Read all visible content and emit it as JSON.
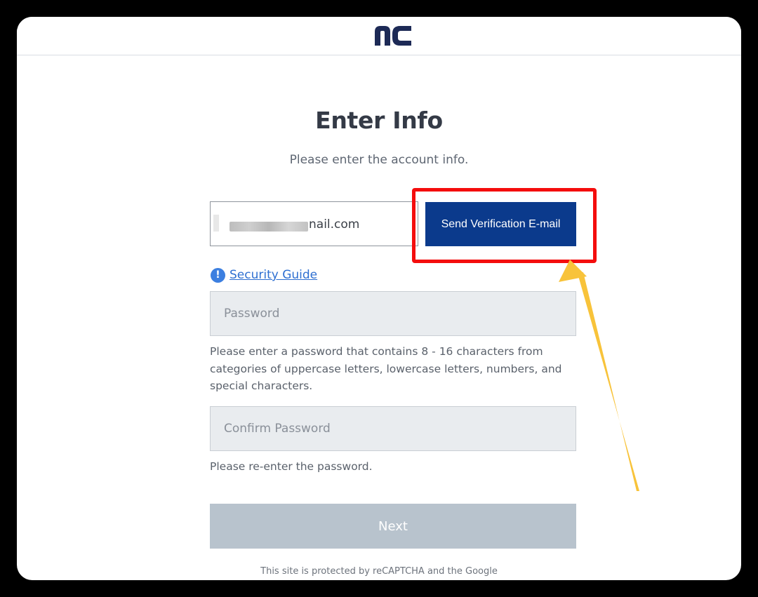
{
  "brand": {
    "logo_text": "nc"
  },
  "form": {
    "title": "Enter Info",
    "subtitle": "Please enter the account info.",
    "email_suffix": "nail.com",
    "send_button_label": "Send Verification E-mail",
    "security_guide_label": "Security Guide",
    "password_placeholder": "Password",
    "password_hint": "Please enter a password that contains 8 - 16 characters from categories of uppercase letters, lowercase letters, numbers, and special characters.",
    "confirm_placeholder": "Confirm Password",
    "confirm_hint": "Please re-enter the password.",
    "next_label": "Next",
    "footer_text": "This site is protected by reCAPTCHA and the Google"
  },
  "icons": {
    "info": "info-icon"
  },
  "colors": {
    "primary": "#0b3a8c",
    "highlight": "#f40d0d",
    "arrow": "#f8c33a",
    "link": "#2e6fd1",
    "disabled_button": "#b8c3cd"
  }
}
